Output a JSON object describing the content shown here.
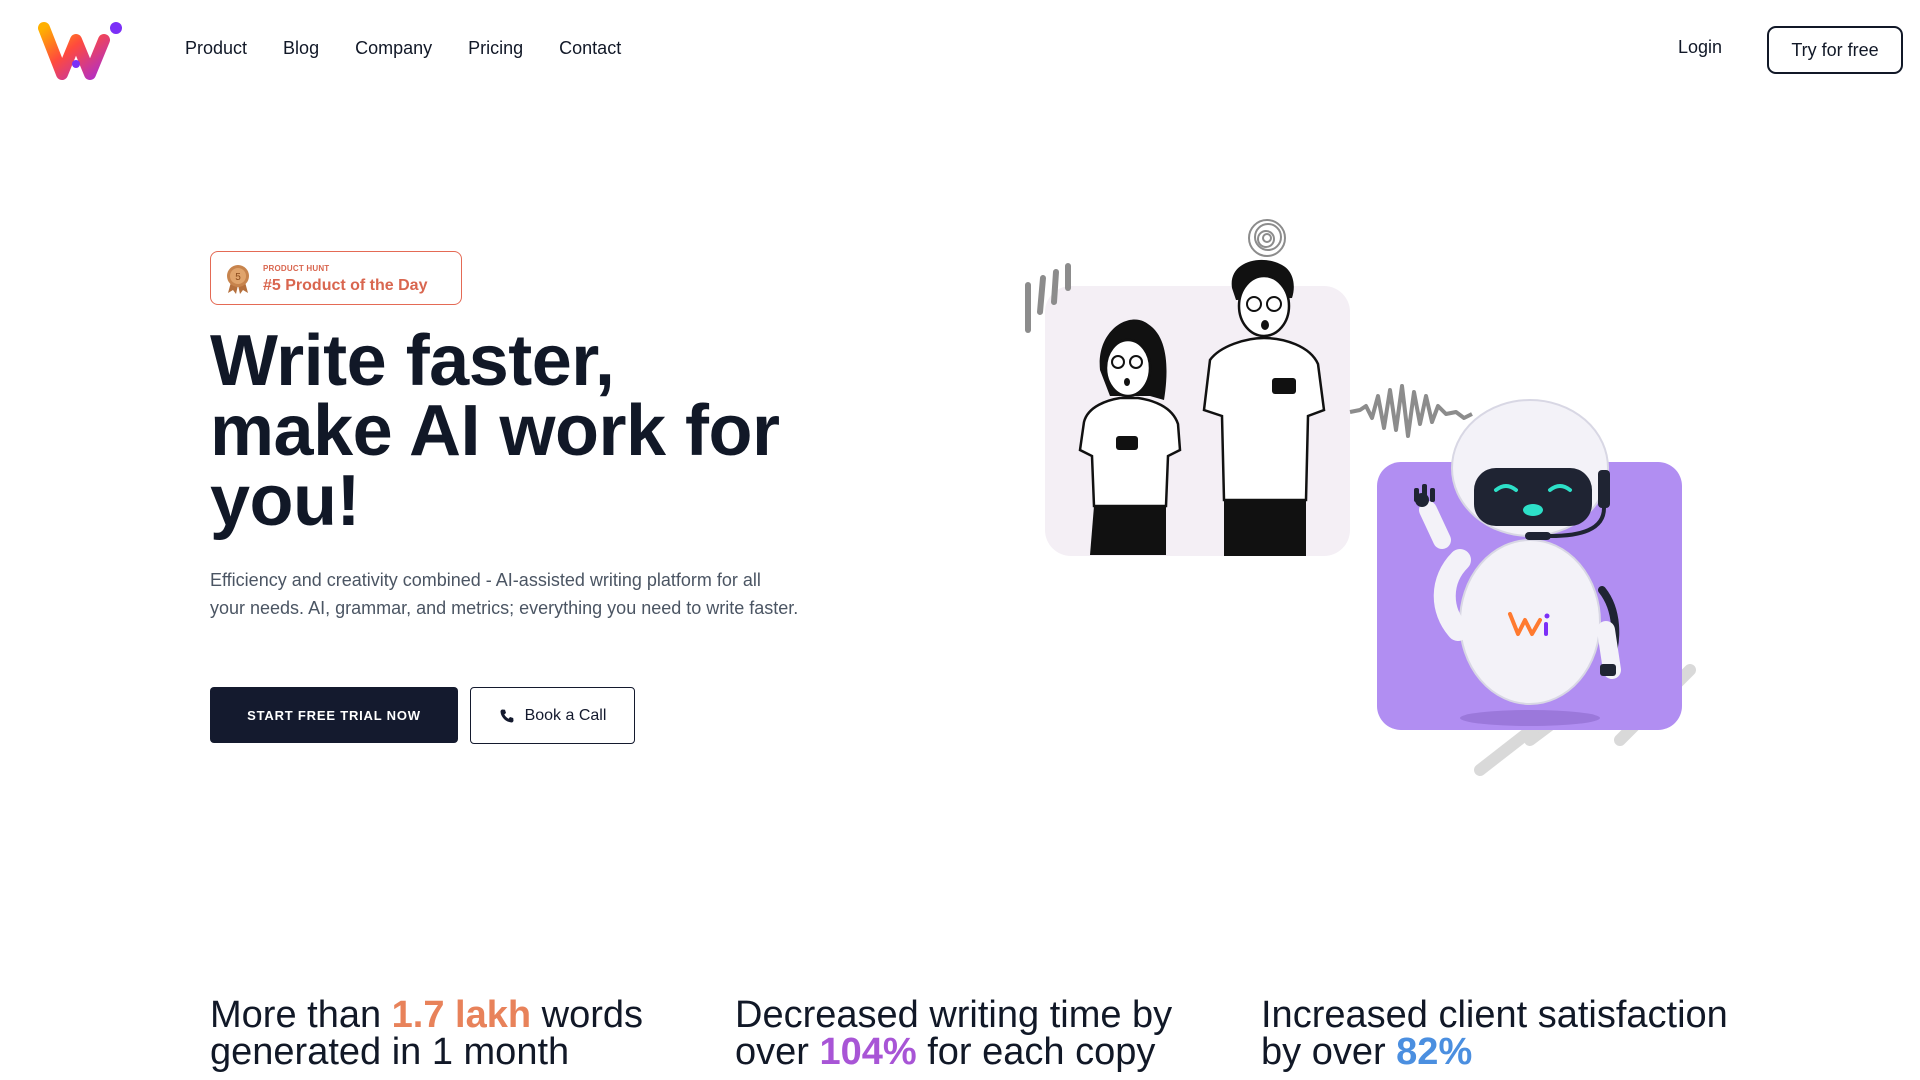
{
  "nav": {
    "links": [
      "Product",
      "Blog",
      "Company",
      "Pricing",
      "Contact"
    ],
    "login_label": "Login",
    "try_label": "Try for free"
  },
  "badge": {
    "small": "PRODUCT HUNT",
    "big": "#5 Product of the Day",
    "medal_number": "5",
    "color": "#d9664f"
  },
  "hero": {
    "title_lines": [
      "Write faster,",
      "make AI work for",
      "you!"
    ],
    "subtitle": "Efficiency and creativity combined - AI-assisted writing platform for all your needs. AI, grammar, and metrics; everything you need to write faster.",
    "primary_cta": "START FREE TRIAL NOW",
    "secondary_cta": "Book a Call"
  },
  "stats": [
    {
      "before": "More than ",
      "highlight": "1.7 lakh",
      "after": " words generated in 1 month",
      "color": "#e8825a"
    },
    {
      "before": "Decreased writing time by over ",
      "highlight": "104%",
      "after": " for each copy",
      "color": "#a855d6"
    },
    {
      "before": "Increased client satisfaction by over ",
      "highlight": "82%",
      "after": "",
      "color": "#4b8fe0"
    }
  ],
  "colors": {
    "dark": "#141a2e",
    "robot_panel": "#b18ef2",
    "people_panel": "#f4eff5"
  },
  "icons": [
    "logo",
    "medal-icon",
    "phone-icon",
    "people-illustration",
    "robot-illustration"
  ]
}
